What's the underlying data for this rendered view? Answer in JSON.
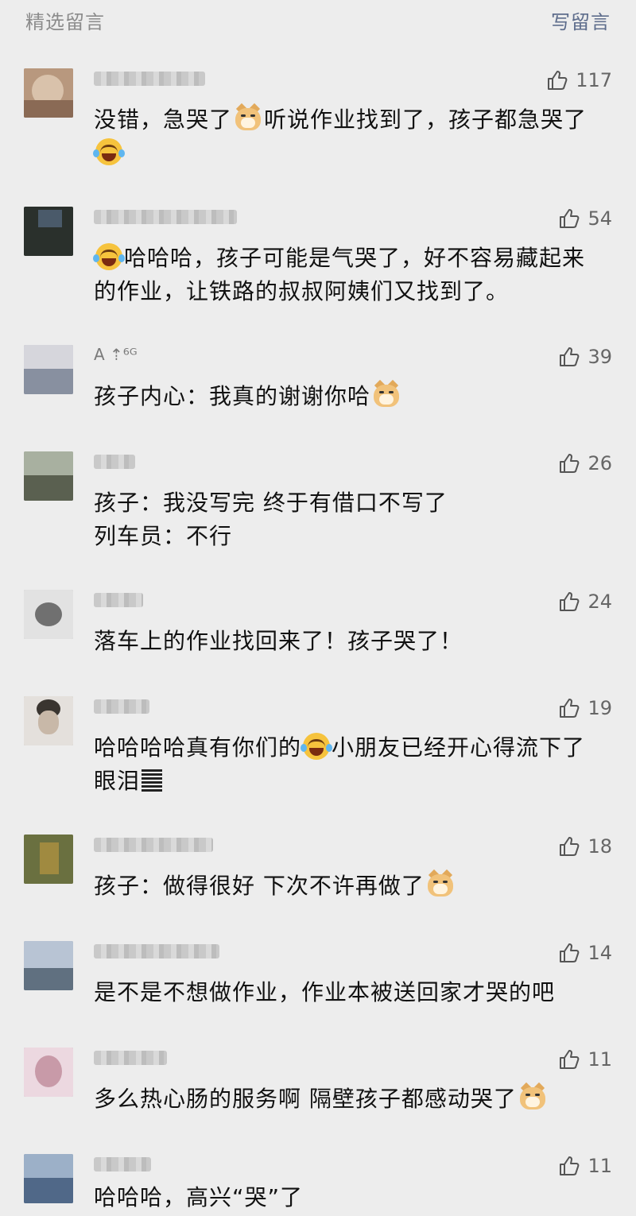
{
  "header": {
    "title": "精选留言",
    "write_label": "写留言"
  },
  "comments": [
    {
      "name": "",
      "likes": "117",
      "lines": [
        "没错，急哭了",
        "听说作业找到了，孩子都急哭了"
      ],
      "avatar_colors": [
        "#b08e74",
        "#d8c0a8",
        "#8a6a55"
      ]
    },
    {
      "name": "",
      "likes": "54",
      "lines": [
        "哈哈哈，孩子可能是气哭了，好不容易藏起来",
        "的作业，让铁路的叔叔阿姨们又找到了。"
      ],
      "avatar_colors": [
        "#2a2f2a",
        "#4a5a6a",
        "#1d2422"
      ]
    },
    {
      "name": "A ⇡⁶ᴳ",
      "likes": "39",
      "lines": [
        "孩子内心：我真的谢谢你哈"
      ],
      "avatar_colors": [
        "#c8c8d0",
        "#8890a0",
        "#e8e8ee"
      ]
    },
    {
      "name": "",
      "likes": "26",
      "lines": [
        "孩子：我没写完 终于有借口不写了",
        "列车员：不行"
      ],
      "avatar_colors": [
        "#7a8070",
        "#a8b0a0",
        "#505848"
      ]
    },
    {
      "name": "",
      "likes": "24",
      "lines": [
        "落车上的作业找回来了！孩子哭了！"
      ],
      "avatar_colors": [
        "#d0d0d0",
        "#606060",
        "#a0a0a0"
      ]
    },
    {
      "name": "",
      "likes": "19",
      "lines": [
        "哈哈哈哈真有你们的",
        "小朋友已经开心得流下了",
        "眼泪"
      ],
      "avatar_colors": [
        "#e0dcd8",
        "#4a4540",
        "#b8b0a8"
      ]
    },
    {
      "name": "",
      "likes": "18",
      "lines": [
        "孩子：做得很好 下次不许再做了"
      ],
      "avatar_colors": [
        "#6a7040",
        "#a09040",
        "#3a4028"
      ]
    },
    {
      "name": "",
      "likes": "14",
      "lines": [
        "是不是不想做作业，作业本被送回家才哭的吧"
      ],
      "avatar_colors": [
        "#98a8c0",
        "#c8d0d8",
        "#607080"
      ]
    },
    {
      "name": "",
      "likes": "11",
      "lines": [
        "多么热心肠的服务啊 隔壁孩子都感动哭了"
      ],
      "avatar_colors": [
        "#e0b8c8",
        "#f0d8e0",
        "#b08898"
      ]
    },
    {
      "name": "",
      "likes": "11",
      "lines": [
        "哈哈哈，高兴“哭”了"
      ],
      "avatar_colors": [
        "#8098b8",
        "#b0c0d8",
        "#506888"
      ]
    }
  ]
}
